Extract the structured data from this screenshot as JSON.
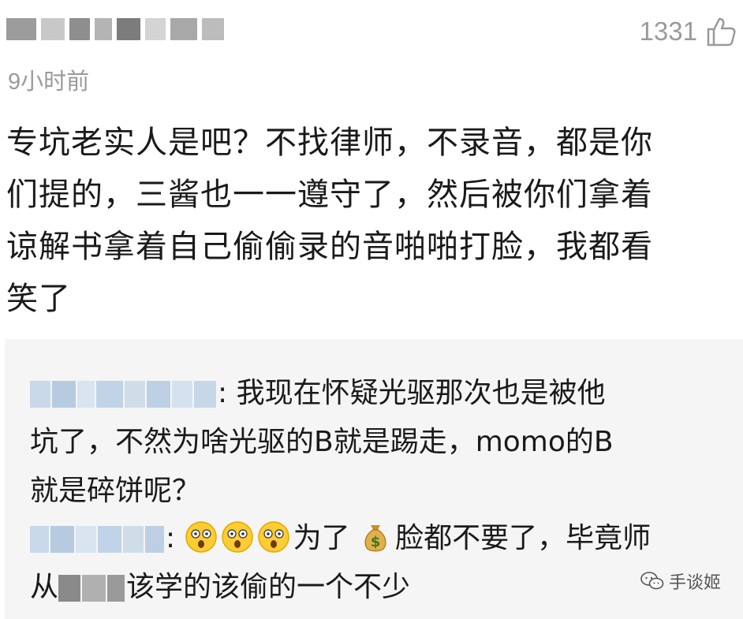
{
  "comment": {
    "time": "9小时前",
    "likes": "1331",
    "lines": [
      "专坑老实人是吧？不找律师，不录音，都是你",
      "们提的，三酱也一一遵守了，然后被你们拿着",
      "谅解书拿着自己偷偷录的音啪啪打脸，我都看",
      "笑了"
    ]
  },
  "replies": [
    {
      "separator": ":",
      "lines": [
        "我现在怀疑光驱那次也是被他",
        "坑了，不然为啥光驱的B就是踢走，momo的B",
        "就是碎饼呢？"
      ]
    },
    {
      "separator": ":",
      "text_after_emojis": "为了",
      "text_after_money": "脸都不要了，毕竟师",
      "line2_prefix": "从",
      "line2_suffix": "该学的该偷的一个不少"
    }
  ],
  "watermark": {
    "label": "手谈姬"
  },
  "icons": {
    "like": "thumbs-up-icon",
    "emoji": "astonished-face-icon",
    "money": "money-bag-icon",
    "wechat": "wechat-icon"
  },
  "colors": {
    "time_gray": "#9a9a9a",
    "reply_bg": "#f5f5f5",
    "blur_blue": "#c9d9ea",
    "blur_gray": "#8a8a8a"
  }
}
